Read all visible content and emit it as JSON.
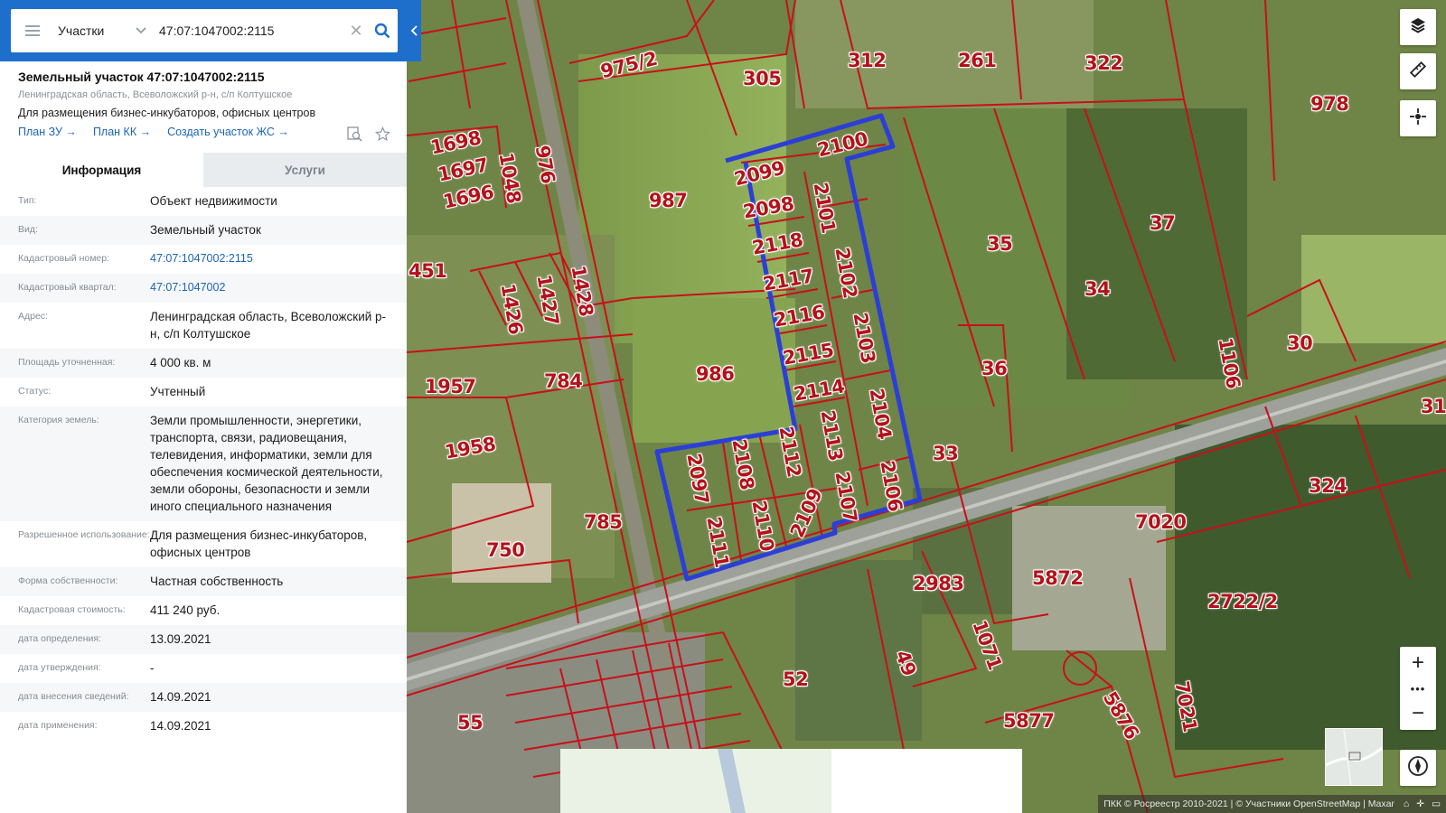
{
  "search": {
    "type_label": "Участки",
    "query": "47:07:1047002:2115"
  },
  "plot": {
    "title": "Земельный участок 47:07:1047002:2115",
    "address_line": "Ленинградская область, Всеволожский р-н, с/п Колтушское",
    "use": "Для размещения бизнес-инкубаторов, офисных центров",
    "links": [
      "План ЗУ →",
      "План КК →",
      "Создать участок ЖС →"
    ]
  },
  "tabs": [
    {
      "label": "Информация",
      "active": true
    },
    {
      "label": "Услуги",
      "active": false
    }
  ],
  "info": [
    {
      "key": "Тип:",
      "value": "Объект недвижимости"
    },
    {
      "key": "Вид:",
      "value": "Земельный участок"
    },
    {
      "key": "Кадастровый номер:",
      "value": "47:07:1047002:2115",
      "link": true
    },
    {
      "key": "Кадастровый квартал:",
      "value": "47:07:1047002",
      "link": true
    },
    {
      "key": "Адрес:",
      "value": "Ленинградская область, Всеволожский р-н, с/п Колтушское"
    },
    {
      "key": "Площадь уточненная:",
      "value": "4 000 кв. м"
    },
    {
      "key": "Статус:",
      "value": "Учтенный"
    },
    {
      "key": "Категория земель:",
      "value": "Земли промышленности, энергетики, транспорта, связи, радиовещания, телевидения, информатики, земли для обеспечения космической деятельности, земли обороны, безопасности и земли иного специального назначения"
    },
    {
      "key": "Разрешенное использование:",
      "value": "Для размещения бизнес-инкубаторов, офисных центров"
    },
    {
      "key": "Форма собственности:",
      "value": "Частная собственность"
    },
    {
      "key": "Кадастровая стоимость:",
      "value": "411 240 руб."
    },
    {
      "key": "дата определения:",
      "value": "13.09.2021"
    },
    {
      "key": "дата утверждения:",
      "value": "-"
    },
    {
      "key": "дата внесения сведений:",
      "value": "14.09.2021"
    },
    {
      "key": "дата применения:",
      "value": "14.09.2021"
    }
  ],
  "map": {
    "attribution": "ПКК © Росреестр 2010-2021 | © Участники OpenStreetMap | Maxar",
    "parcel_labels": [
      "975/2",
      "305",
      "312",
      "261",
      "322",
      "978",
      "1698",
      "1697",
      "1696",
      "1048",
      "976",
      "987",
      "2099",
      "2100",
      "2098",
      "2101",
      "2118",
      "2102",
      "2117",
      "2116",
      "2103",
      "2115",
      "2114",
      "2104",
      "2113",
      "2112",
      "2108",
      "2097",
      "2107",
      "2106",
      "2109",
      "2110",
      "2111",
      "986",
      "784",
      "1957",
      "1958",
      "785",
      "750",
      "1426",
      "1427",
      "1428",
      "451",
      "35",
      "37",
      "34",
      "36",
      "30",
      "1106",
      "33",
      "324",
      "7020",
      "5872",
      "2983",
      "2722/2",
      "1071",
      "52",
      "49",
      "55",
      "5877",
      "5876",
      "7021",
      "31"
    ],
    "colors": {
      "parcel_border": "#c8101a",
      "selected_border": "#2b3fd6",
      "panel_accent": "#1e6fcb"
    }
  },
  "icons": [
    "menu-icon",
    "chevron-down-icon",
    "clear-icon",
    "search-icon",
    "collapse-arrow-icon",
    "find-on-map-icon",
    "star-icon",
    "layers-icon",
    "ruler-icon",
    "locate-icon",
    "zoom-in-icon",
    "zoom-out-icon",
    "compass-icon"
  ]
}
